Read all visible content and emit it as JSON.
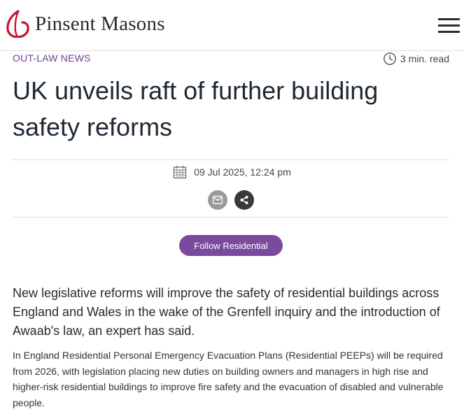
{
  "header": {
    "logo_text": "Pinsent Masons",
    "menu_icon": "hamburger-menu-icon"
  },
  "article": {
    "kicker": "OUT-LAW NEWS",
    "read_time": "3 min. read",
    "title_line1": "UK unveils raft of further building",
    "title_line2": "safety reforms",
    "date": "09 Jul 2025, 12:24 pm",
    "share_icons": [
      "email-icon",
      "share-icon"
    ],
    "follow_label": "Follow Residential",
    "lead": "New legislative reforms will improve the safety of residential buildings across England and Wales in the wake of the Grenfell inquiry and the introduction of Awaab's law, an expert has said.",
    "body": "In England Residential Personal Emergency Evacuation Plans (Residential PEEPs) will be required from 2026, with legislation placing new duties on building owners and managers in high rise and higher-risk residential buildings to improve fire safety and the evacuation of disabled and vulnerable people."
  },
  "colors": {
    "accent": "#7a4a9e",
    "logo_red": "#c8102e",
    "kicker": "#6d3f92"
  }
}
